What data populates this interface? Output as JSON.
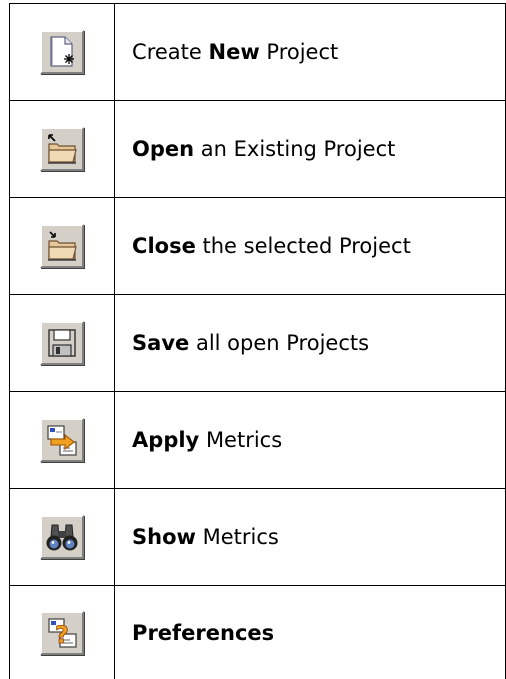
{
  "rows": [
    {
      "icon": "new-document-icon",
      "bold": "New",
      "before": "Create ",
      "after": " Project"
    },
    {
      "icon": "open-folder-icon",
      "bold": "Open",
      "before": "",
      "after": " an Existing Project"
    },
    {
      "icon": "close-folder-icon",
      "bold": "Close",
      "before": "",
      "after": " the selected Project"
    },
    {
      "icon": "save-disk-icon",
      "bold": "Save",
      "before": "",
      "after": " all open Projects"
    },
    {
      "icon": "apply-metrics-icon",
      "bold": "Apply",
      "before": "",
      "after": " Metrics"
    },
    {
      "icon": "binoculars-icon",
      "bold": "Show",
      "before": "",
      "after": " Metrics"
    },
    {
      "icon": "preferences-icon",
      "bold": "Preferences",
      "before": "",
      "after": ""
    }
  ]
}
